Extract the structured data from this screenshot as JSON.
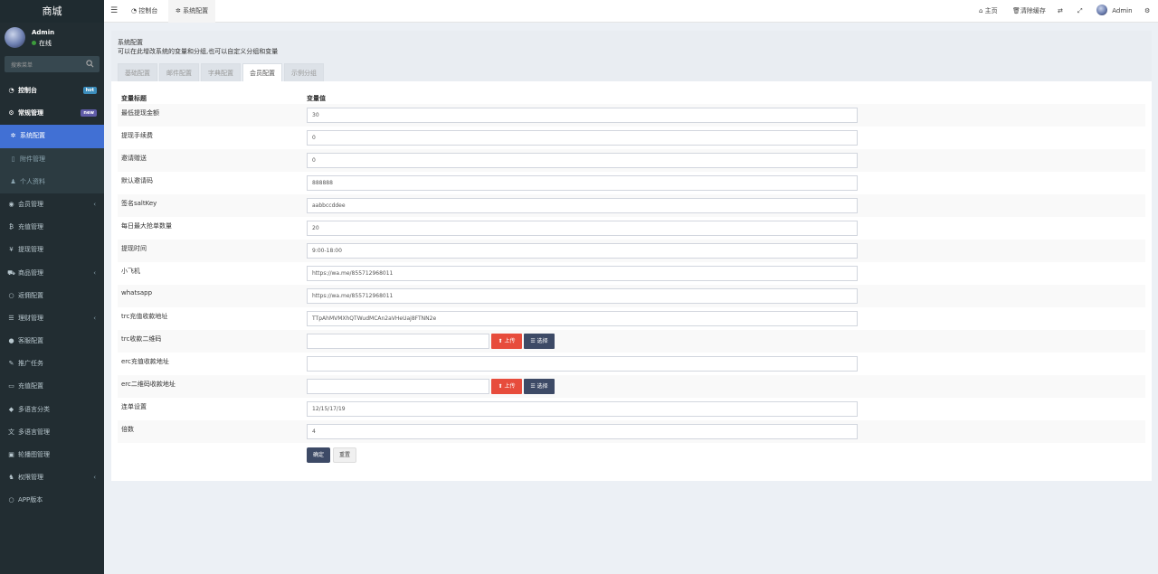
{
  "brand": "商城",
  "user": {
    "name": "Admin",
    "status": "在线"
  },
  "search": {
    "placeholder": "搜索菜单"
  },
  "menu": {
    "dashboard": {
      "label": "控制台",
      "badge": "hot",
      "badge_color": "#3c8dbc"
    },
    "general": {
      "label": "常规管理",
      "badge": "new",
      "badge_color": "#605ca8"
    },
    "sub": [
      "系统配置",
      "附件管理",
      "个人资料"
    ],
    "items": [
      "会员管理",
      "充值管理",
      "提现管理",
      "商品管理",
      "返佣配置",
      "理财管理",
      "客服配置",
      "推广任务",
      "充值配置",
      "多语言分类",
      "多语言管理",
      "轮播图管理",
      "权限管理",
      "APP版本"
    ]
  },
  "topbar": {
    "tabs": [
      "控制台",
      "系统配置"
    ],
    "home": "主页",
    "clear_cache": "清除缓存",
    "admin": "Admin"
  },
  "header": {
    "title": "系统配置",
    "desc": "可以在此增改系统的变量和分组,也可以自定义分组和变量"
  },
  "tabs": [
    "基础配置",
    "邮件配置",
    "字典配置",
    "会员配置",
    "示例分组"
  ],
  "active_tab": "会员配置",
  "table": {
    "col_title": "变量标题",
    "col_value": "变量值",
    "rows": [
      {
        "label": "最低提现金额",
        "value": "30"
      },
      {
        "label": "提现手续费",
        "value": "0"
      },
      {
        "label": "邀请赠送",
        "value": "0"
      },
      {
        "label": "默认邀请码",
        "value": "888888"
      },
      {
        "label": "签名saltKey",
        "value": "aabbccddee"
      },
      {
        "label": "每日最大抢单数量",
        "value": "20"
      },
      {
        "label": "提现时间",
        "value": "9:00-18:00"
      },
      {
        "label": "小飞机",
        "value": "https://wa.me/855712968011"
      },
      {
        "label": "whatsapp",
        "value": "https://wa.me/855712968011"
      },
      {
        "label": "trc充值收款地址",
        "value": "TTpAhMVMXhQTWudMCAn2aVHeUaj8FTNN2e"
      },
      {
        "label": "trc收款二维码",
        "value": ""
      },
      {
        "label": "erc充值收款地址",
        "value": ""
      },
      {
        "label": "erc二维码收款地址",
        "value": ""
      },
      {
        "label": "连单设置",
        "value": "12/15/17/19"
      },
      {
        "label": "倍数",
        "value": "4"
      }
    ]
  },
  "buttons": {
    "upload": "上传",
    "choose": "选择",
    "submit": "确定",
    "reset": "重置"
  },
  "colors": {
    "sidebar": "#222d32",
    "active": "#4170d4",
    "upload": "#e74c3c",
    "primary": "#3d4a66"
  }
}
